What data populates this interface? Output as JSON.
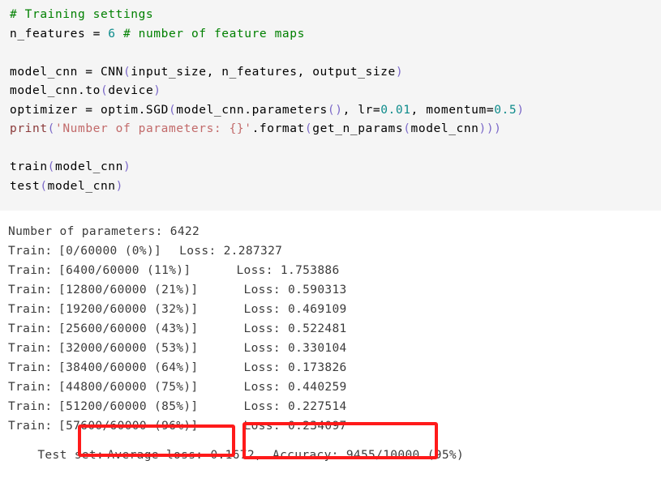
{
  "colors": {
    "code_background": "#f5f5f5",
    "output_background": "#ffffff",
    "comment": "#008000",
    "number": "#0d8b8b",
    "paren": "#7b68c8",
    "builtin": "#8b3a3a",
    "string": "#c26a6a",
    "output_text": "#3b3b3b",
    "highlight": "#ff1a1a"
  },
  "code_cell": {
    "lines": [
      {
        "id": "l1",
        "text": "# Training settings",
        "tokens": [
          {
            "t": "# Training settings",
            "c": "comment"
          }
        ]
      },
      {
        "id": "l2",
        "text": "n_features = 6 # number of feature maps",
        "tokens": [
          {
            "t": "n_features = ",
            "c": "plain"
          },
          {
            "t": "6",
            "c": "num"
          },
          {
            "t": " ",
            "c": "plain"
          },
          {
            "t": "# number of feature maps",
            "c": "comment"
          }
        ]
      },
      {
        "id": "l3",
        "text": "",
        "tokens": []
      },
      {
        "id": "l4",
        "text": "model_cnn = CNN(input_size, n_features, output_size)",
        "tokens": [
          {
            "t": "model_cnn = CNN",
            "c": "plain"
          },
          {
            "t": "(",
            "c": "paren"
          },
          {
            "t": "input_size, n_features, output_size",
            "c": "plain"
          },
          {
            "t": ")",
            "c": "paren"
          }
        ]
      },
      {
        "id": "l5",
        "text": "model_cnn.to(device)",
        "tokens": [
          {
            "t": "model_cnn.to",
            "c": "plain"
          },
          {
            "t": "(",
            "c": "paren"
          },
          {
            "t": "device",
            "c": "plain"
          },
          {
            "t": ")",
            "c": "paren"
          }
        ]
      },
      {
        "id": "l6",
        "text": "optimizer = optim.SGD(model_cnn.parameters(), lr=0.01, momentum=0.5)",
        "tokens": [
          {
            "t": "optimizer = optim.SGD",
            "c": "plain"
          },
          {
            "t": "(",
            "c": "paren"
          },
          {
            "t": "model_cnn.parameters",
            "c": "plain"
          },
          {
            "t": "()",
            "c": "paren"
          },
          {
            "t": ", lr=",
            "c": "plain"
          },
          {
            "t": "0.01",
            "c": "num"
          },
          {
            "t": ", momentum=",
            "c": "plain"
          },
          {
            "t": "0.5",
            "c": "num"
          },
          {
            "t": ")",
            "c": "paren"
          }
        ]
      },
      {
        "id": "l7",
        "text": "print('Number of parameters: {}'.format(get_n_params(model_cnn)))",
        "tokens": [
          {
            "t": "print",
            "c": "fn"
          },
          {
            "t": "(",
            "c": "paren"
          },
          {
            "t": "'Number of parameters: {}'",
            "c": "str"
          },
          {
            "t": ".format",
            "c": "plain"
          },
          {
            "t": "(",
            "c": "paren"
          },
          {
            "t": "get_n_params",
            "c": "plain"
          },
          {
            "t": "(",
            "c": "paren"
          },
          {
            "t": "model_cnn",
            "c": "plain"
          },
          {
            "t": ")))",
            "c": "paren"
          }
        ]
      },
      {
        "id": "l8",
        "text": "",
        "tokens": []
      },
      {
        "id": "l9",
        "text": "train(model_cnn)",
        "tokens": [
          {
            "t": "train",
            "c": "plain"
          },
          {
            "t": "(",
            "c": "paren"
          },
          {
            "t": "model_cnn",
            "c": "plain"
          },
          {
            "t": ")",
            "c": "paren"
          }
        ]
      },
      {
        "id": "l10",
        "text": "test(model_cnn)",
        "tokens": [
          {
            "t": "test",
            "c": "plain"
          },
          {
            "t": "(",
            "c": "paren"
          },
          {
            "t": "model_cnn",
            "c": "plain"
          },
          {
            "t": ")",
            "c": "paren"
          }
        ]
      }
    ]
  },
  "output": {
    "param_count_line": "Number of parameters: 6422",
    "param_count": "6422",
    "train_rows": [
      {
        "label": "Train:",
        "progress": "[0/60000 (0%)]",
        "loss": "Loss: 2.287327",
        "loss_value": "2.287327",
        "seen": "0",
        "total": "60000",
        "percent": "0%",
        "indent": 1
      },
      {
        "label": "Train:",
        "progress": "[6400/60000 (11%)]",
        "loss": "Loss: 1.753886",
        "loss_value": "1.753886",
        "seen": "6400",
        "total": "60000",
        "percent": "11%",
        "indent": 2
      },
      {
        "label": "Train:",
        "progress": "[12800/60000 (21%)]",
        "loss": "Loss: 0.590313",
        "loss_value": "0.590313",
        "seen": "12800",
        "total": "60000",
        "percent": "21%",
        "indent": 2
      },
      {
        "label": "Train:",
        "progress": "[19200/60000 (32%)]",
        "loss": "Loss: 0.469109",
        "loss_value": "0.469109",
        "seen": "19200",
        "total": "60000",
        "percent": "32%",
        "indent": 2
      },
      {
        "label": "Train:",
        "progress": "[25600/60000 (43%)]",
        "loss": "Loss: 0.522481",
        "loss_value": "0.522481",
        "seen": "25600",
        "total": "60000",
        "percent": "43%",
        "indent": 2
      },
      {
        "label": "Train:",
        "progress": "[32000/60000 (53%)]",
        "loss": "Loss: 0.330104",
        "loss_value": "0.330104",
        "seen": "32000",
        "total": "60000",
        "percent": "53%",
        "indent": 2
      },
      {
        "label": "Train:",
        "progress": "[38400/60000 (64%)]",
        "loss": "Loss: 0.173826",
        "loss_value": "0.173826",
        "seen": "38400",
        "total": "60000",
        "percent": "64%",
        "indent": 2
      },
      {
        "label": "Train:",
        "progress": "[44800/60000 (75%)]",
        "loss": "Loss: 0.440259",
        "loss_value": "0.440259",
        "seen": "44800",
        "total": "60000",
        "percent": "75%",
        "indent": 2
      },
      {
        "label": "Train:",
        "progress": "[51200/60000 (85%)]",
        "loss": "Loss: 0.227514",
        "loss_value": "0.227514",
        "seen": "51200",
        "total": "60000",
        "percent": "85%",
        "indent": 2
      },
      {
        "label": "Train:",
        "progress": "[57600/60000 (96%)]",
        "loss": "Loss: 0.234097",
        "loss_value": "0.234097",
        "seen": "57600",
        "total": "60000",
        "percent": "96%",
        "indent": 2
      }
    ],
    "test_line": {
      "prefix": "Test set: ",
      "average_loss": "Average loss: 0.1672,",
      "average_loss_value": "0.1672",
      "accuracy": "Accuracy: 9455/10000 (95%)",
      "accuracy_correct": "9455",
      "accuracy_total": "10000",
      "accuracy_percent": "95%"
    }
  },
  "annotations": [
    {
      "id": "hl-loss",
      "name": "highlight-box-average-loss",
      "target": "Average loss: 0.1672,"
    },
    {
      "id": "hl-accuracy",
      "name": "highlight-box-accuracy",
      "target": "Accuracy: 9455/10000 (95%)"
    }
  ]
}
